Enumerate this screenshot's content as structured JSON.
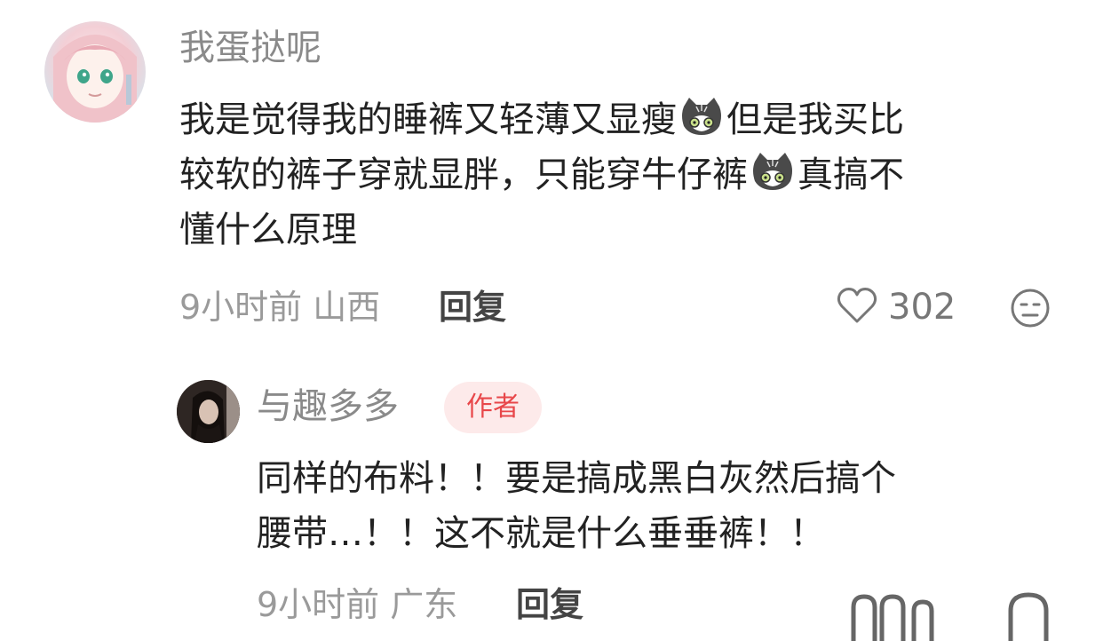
{
  "comments": [
    {
      "username": "我蛋挞呢",
      "lines": [
        [
          "我是觉得我的睡裤又轻薄又显瘦",
          "但是我买比"
        ],
        [
          "较软的裤子穿就显胖，只能穿牛仔裤",
          "真搞不"
        ],
        [
          "懂什么原理"
        ]
      ],
      "emoji_icon": "cat-emoji-icon",
      "time": "9小时前",
      "location": "山西",
      "reply_label": "回复",
      "likes": "302"
    },
    {
      "username": "与趣多多",
      "badge": "作者",
      "lines": [
        "同样的布料！！要是搞成黑白灰然后搞个",
        "腰带…！！这不就是什么垂垂裤！！"
      ],
      "time": "9小时前",
      "location": "广东",
      "reply_label": "回复"
    }
  ],
  "colors": {
    "username": "#8a8a8a",
    "badge_text": "#e8474a",
    "badge_bg": "#fdeaea",
    "body_text": "#222222",
    "meta_text": "#9a9a9a"
  }
}
